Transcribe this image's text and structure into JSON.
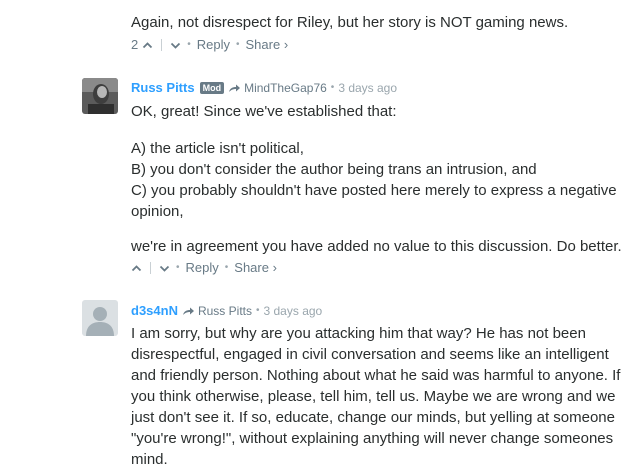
{
  "top_comment": {
    "text": "Again, not disrespect for Riley, but her story is NOT gaming news.",
    "upvotes": "2",
    "reply_label": "Reply",
    "share_label": "Share ›"
  },
  "comment1": {
    "author": "Russ Pitts",
    "badge": "Mod",
    "reply_to": "MindTheGap76",
    "time": "3 days ago",
    "paragraphs": [
      "OK, great! Since we've established that:",
      "A) the article isn't political,",
      "B) you don't consider the author being trans an intrusion, and",
      "C) you probably shouldn't have posted here merely to express a negative opinion,",
      "we're in agreement you have added no value to this discussion. Do better."
    ],
    "reply_label": "Reply",
    "share_label": "Share ›"
  },
  "comment2": {
    "author": "d3s4nN",
    "reply_to": "Russ Pitts",
    "time": "3 days ago",
    "text": "I am sorry, but why are you attacking him that way? He has not been disrespectful, engaged in civil conversation and seems like an intelligent and friendly person. Nothing about what he said was harmful to anyone. If you think otherwise, please, tell him, tell us. Maybe we are wrong and we just don't see it. If so, educate, change our minds, but yelling at someone \"you're wrong!\", without explaining anything will never change someones mind."
  },
  "icons": {
    "upvote": "chevron-up-icon",
    "downvote": "chevron-down-icon",
    "reply_arrow": "reply-arrow-icon"
  },
  "colors": {
    "author_link": "#2e9fff",
    "meta_gray": "#687a86",
    "body_text": "#2a2e2e"
  }
}
